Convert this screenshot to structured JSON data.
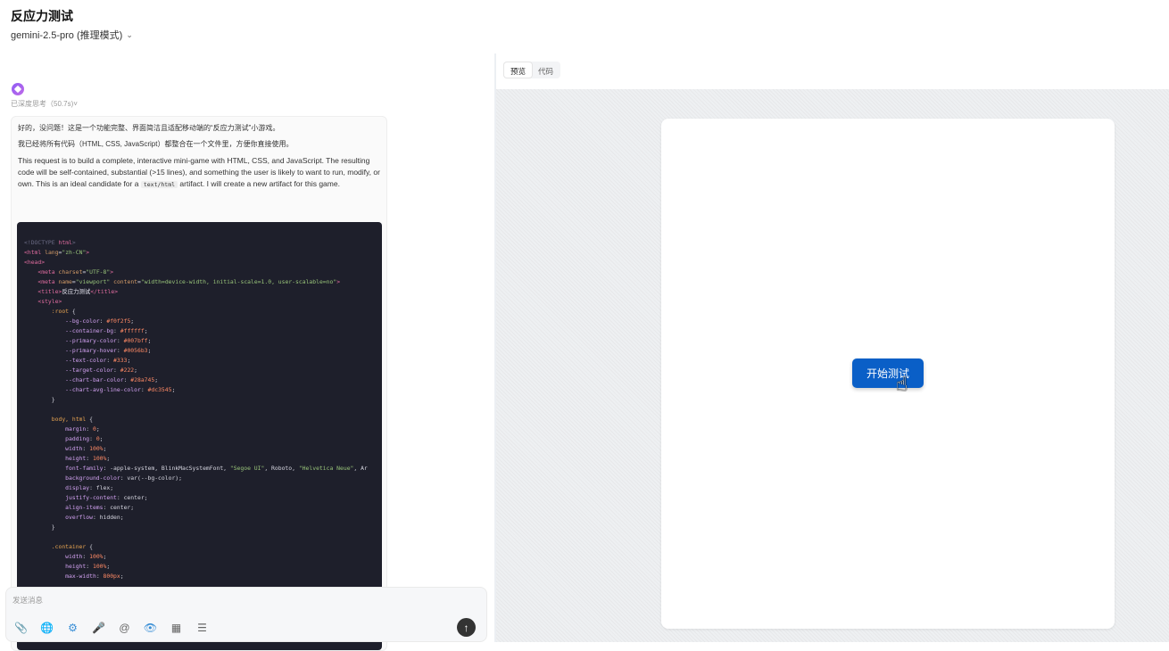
{
  "header": {
    "title": "反应力测试",
    "model_label": "gemini-2.5-pro (推理模式)"
  },
  "chat": {
    "thinking_label": "已深度思考（50.7s)",
    "paragraphs": [
      "好的，没问题！这是一个功能完整、界面简洁且适配移动端的“反应力测试”小游戏。",
      "我已经将所有代码（HTML, CSS, JavaScript）都整合在一个文件里，方便你直接使用。"
    ],
    "para3_before": "This request is to build a complete, interactive mini-game with HTML, CSS, and JavaScript. The resulting code will be self-contained, substantial (>15 lines), and something the user is likely to want to run, modify, or own. This is an ideal candidate for a ",
    "para3_code": "text/html",
    "para3_after": " artifact. I will create a new artifact for this game."
  },
  "input": {
    "placeholder": "发送消息",
    "tools": [
      "attach-icon",
      "globe-icon",
      "brain-icon",
      "mic-icon",
      "at-icon",
      "eye-icon",
      "apps-icon",
      "list-icon"
    ]
  },
  "preview": {
    "tabs": [
      "预览",
      "代码"
    ],
    "active_tab": "预览",
    "start_button": "开始测试"
  },
  "colors": {
    "code_bg": "#1e1f2b",
    "button_blue": "#0a5fc7",
    "accent": "#3a8fd6"
  }
}
